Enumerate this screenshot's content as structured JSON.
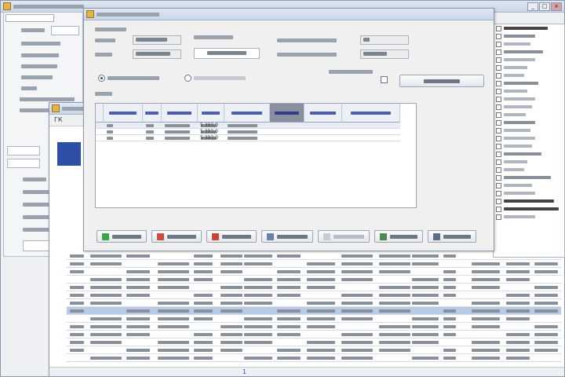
{
  "colors": {
    "title_bar": "#c9d7e8",
    "selected_row": "#b7cbe6",
    "header_dark": "#8a8fa0",
    "header_text": "#2e3d88",
    "add_icon": "#3aa64a",
    "delete_icon": "#d04a3a",
    "print_icon": "#cc4433",
    "find_icon": "#6b7fa8",
    "save_icon": "#4a8a4a",
    "close_icon": "#5b6c88"
  },
  "icons": [
    "add-icon",
    "delete-icon",
    "print-icon",
    "find-icon",
    "save-icon",
    "close-icon"
  ],
  "dialog": {
    "tab_label": "ГК",
    "footer_page": "1"
  },
  "main_grid": {
    "row_count": 3,
    "selected_row": 0,
    "value_column_text": "5 393,0"
  },
  "back_grid": {
    "visible_rows": 14,
    "selected_row": 7
  }
}
